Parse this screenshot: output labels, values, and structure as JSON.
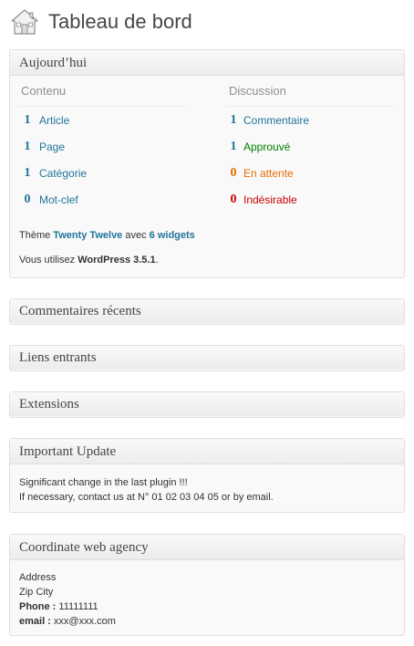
{
  "header": {
    "title": "Tableau de bord",
    "icon": "home-icon"
  },
  "now_box": {
    "title": "Aujourd’hui",
    "content": {
      "heading": "Contenu",
      "items": [
        {
          "count": "1",
          "label": "Article"
        },
        {
          "count": "1",
          "label": "Page"
        },
        {
          "count": "1",
          "label": "Catégorie"
        },
        {
          "count": "0",
          "label": "Mot-clef"
        }
      ]
    },
    "discussion": {
      "heading": "Discussion",
      "items": [
        {
          "count": "1",
          "label": "Commentaire",
          "color": "#21759b"
        },
        {
          "count": "1",
          "label": "Approuvé",
          "color": "#008000"
        },
        {
          "count": "0",
          "label": "En attente",
          "color": "#e66f00"
        },
        {
          "count": "0",
          "label": "Indésirable",
          "color": "#cc0000"
        }
      ]
    },
    "theme_prefix": "Thème ",
    "theme_name": "Twenty Twelve",
    "theme_middle": " avec ",
    "theme_widgets": "6 widgets",
    "version_prefix": "Vous utilisez ",
    "version_name": "WordPress 3.5.1",
    "version_suffix": "."
  },
  "recent_comments": {
    "title": "Commentaires récents"
  },
  "incoming_links": {
    "title": "Liens entrants"
  },
  "extensions": {
    "title": "Extensions"
  },
  "important_update": {
    "title": "Important Update",
    "line1": "Significant change in the last plugin !!!",
    "line2": "If necessary, contact us at N° 01 02 03 04 05 or by email."
  },
  "agency": {
    "title": "Coordinate web agency",
    "address": "Address",
    "zip_city": "Zip City",
    "phone_label": "Phone :",
    "phone_value": " 11111111",
    "email_label": "email :",
    "email_value": " xxx@xxx.com"
  }
}
